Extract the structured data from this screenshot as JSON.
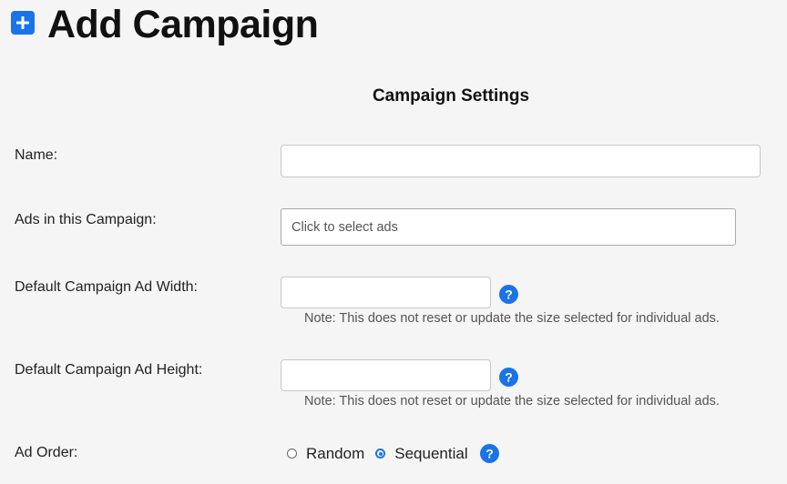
{
  "header": {
    "title": "Add Campaign",
    "icon": "plus-square-icon",
    "icon_color": "#1a73e8"
  },
  "section": {
    "title": "Campaign Settings"
  },
  "fields": {
    "name": {
      "label": "Name:",
      "value": ""
    },
    "ads": {
      "label": "Ads in this Campaign:",
      "placeholder": "Click to select ads"
    },
    "width": {
      "label": "Default Campaign Ad Width:",
      "value": "",
      "note": "Note: This does not reset or update the size selected for individual ads."
    },
    "height": {
      "label": "Default Campaign Ad Height:",
      "value": "",
      "note": "Note: This does not reset or update the size selected for individual ads."
    },
    "order": {
      "label": "Ad Order:",
      "options": [
        {
          "label": "Random",
          "selected": false
        },
        {
          "label": "Sequential",
          "selected": true
        }
      ]
    }
  }
}
